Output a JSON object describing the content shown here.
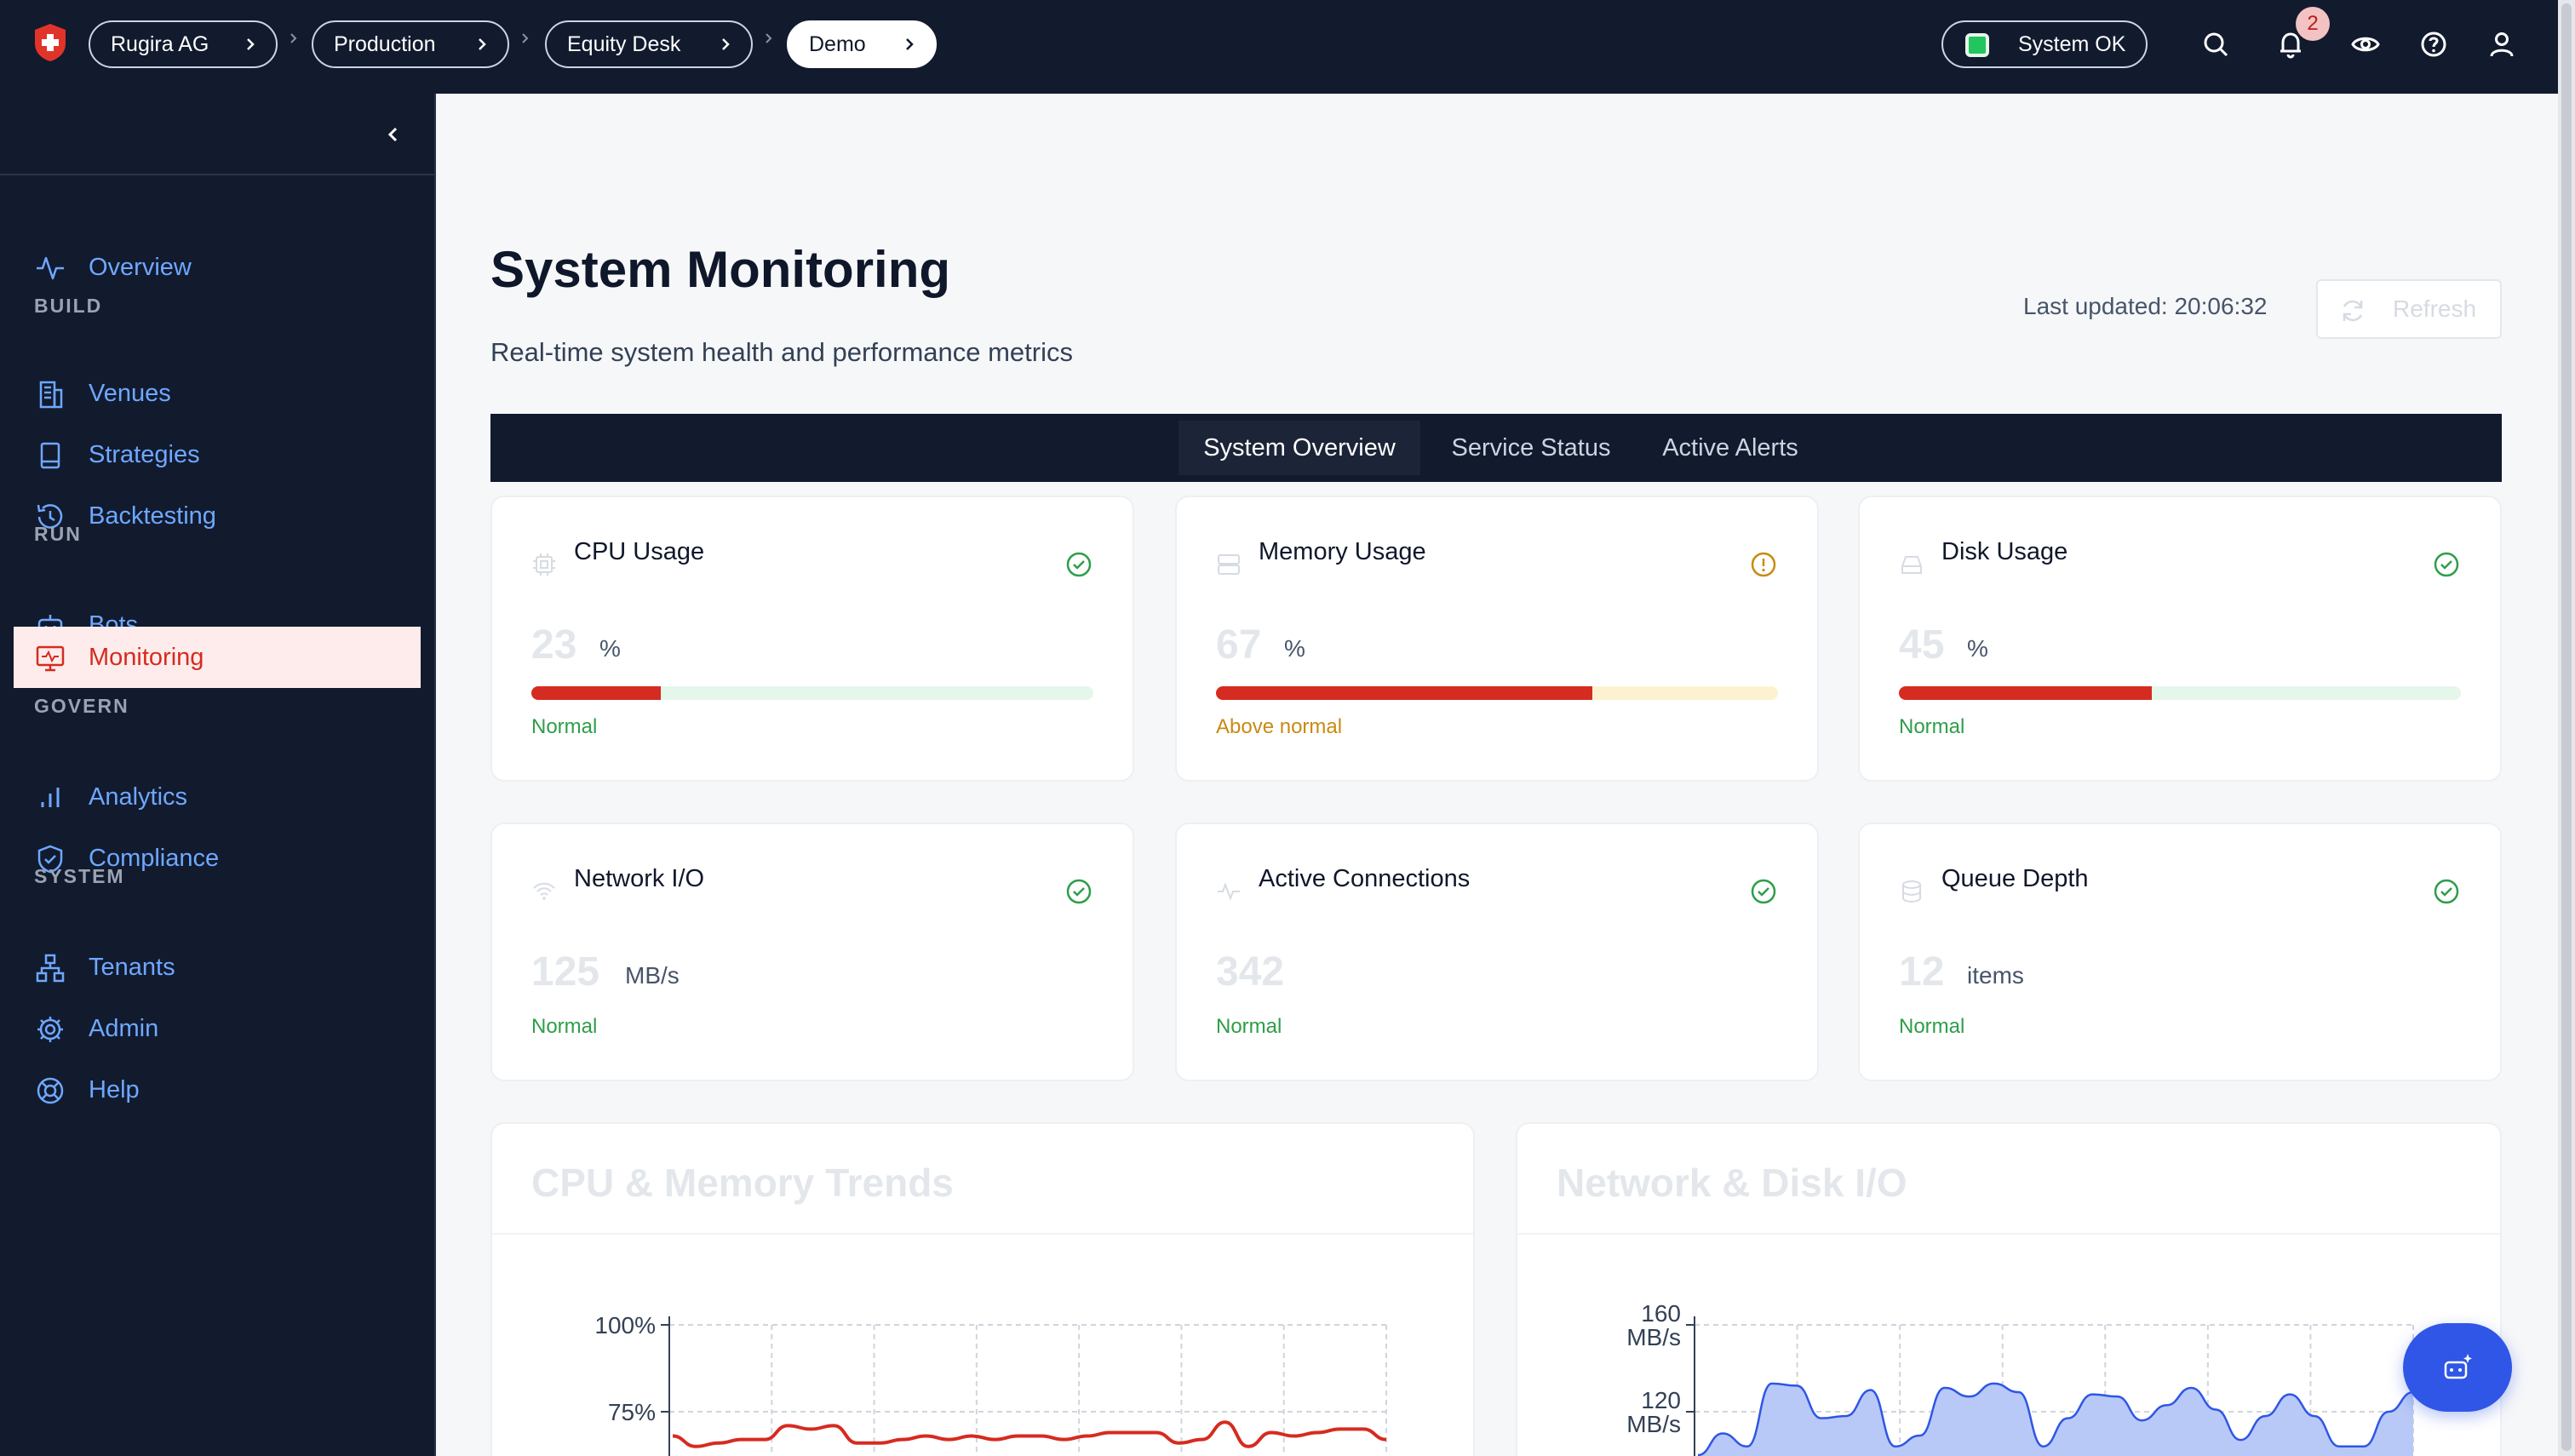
{
  "topbar": {
    "breadcrumbs": [
      "Rugira AG",
      "Production",
      "Equity Desk",
      "Demo"
    ],
    "system_status": "System OK",
    "notification_count": "2"
  },
  "sidebar": {
    "items": [
      {
        "label": "Overview",
        "icon": "activity-icon"
      },
      {
        "section": "BUILD"
      },
      {
        "label": "Venues",
        "icon": "building-icon"
      },
      {
        "label": "Strategies",
        "icon": "notebook-icon"
      },
      {
        "label": "Backtesting",
        "icon": "history-icon"
      },
      {
        "section": "RUN"
      },
      {
        "label": "Bots",
        "icon": "bot-icon"
      },
      {
        "label": "Monitoring",
        "icon": "monitor-icon",
        "active": true
      },
      {
        "section": "GOVERN"
      },
      {
        "label": "Analytics",
        "icon": "bar-chart-icon"
      },
      {
        "label": "Compliance",
        "icon": "shield-check-icon"
      },
      {
        "section": "SYSTEM"
      },
      {
        "label": "Tenants",
        "icon": "network-icon"
      },
      {
        "label": "Admin",
        "icon": "gear-icon"
      },
      {
        "label": "Help",
        "icon": "lifebuoy-icon"
      }
    ]
  },
  "page": {
    "title": "System Monitoring",
    "subtitle": "Real-time system health and performance metrics",
    "last_updated": "Last updated: 20:06:32",
    "refresh_label": "Refresh",
    "tabs": [
      "System Overview",
      "Service Status",
      "Active Alerts"
    ],
    "active_tab": "System Overview"
  },
  "metrics": [
    {
      "title": "CPU Usage",
      "value": "23",
      "unit": "%",
      "percent": 23,
      "status": "Normal",
      "status_color": "#2e9e48"
    },
    {
      "title": "Memory Usage",
      "value": "67",
      "unit": "%",
      "percent": 67,
      "status": "Above normal",
      "status_color": "#c98a12"
    },
    {
      "title": "Disk Usage",
      "value": "45",
      "unit": "%",
      "percent": 45,
      "status": "Normal",
      "status_color": "#2e9e48"
    },
    {
      "title": "Network I/O",
      "value": "125",
      "unit": "MB/s",
      "status": "Normal",
      "status_color": "#2e9e48"
    },
    {
      "title": "Active Connections",
      "value": "342",
      "unit": "",
      "status": "Normal",
      "status_color": "#2e9e48"
    },
    {
      "title": "Queue Depth",
      "value": "12",
      "unit": "items",
      "status": "Normal",
      "status_color": "#2e9e48"
    }
  ],
  "chart_data": [
    {
      "type": "line",
      "title": "CPU & Memory Trends",
      "y_ticks": [
        "100%",
        "75%"
      ],
      "ylim": [
        0,
        100
      ],
      "grid": true,
      "series": [
        {
          "values": [
            68,
            65,
            66,
            67,
            67,
            71,
            70,
            71,
            66,
            66,
            67,
            68,
            67,
            68,
            67,
            68,
            68,
            67,
            68,
            69,
            69,
            69,
            66,
            67,
            72,
            65,
            69,
            68,
            69,
            70,
            70,
            67
          ],
          "color": "#d62b20"
        }
      ]
    },
    {
      "type": "area",
      "title": "Network & Disk I/O",
      "y_ticks": [
        "160 MB/s",
        "120 MB/s"
      ],
      "ylim": [
        0,
        160
      ],
      "grid": true,
      "series": [
        {
          "values": [
            100,
            110,
            104,
            133,
            132,
            117,
            118,
            130,
            104,
            109,
            131,
            127,
            133,
            129,
            104,
            117,
            128,
            127,
            116,
            123,
            131,
            121,
            107,
            118,
            128,
            118,
            104,
            104,
            120,
            129
          ],
          "color": "#2f56e6"
        }
      ]
    }
  ]
}
